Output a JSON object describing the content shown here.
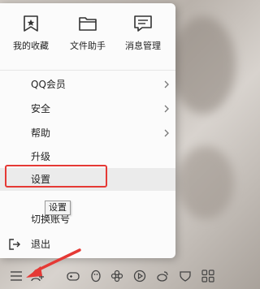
{
  "quick_actions": [
    {
      "label": "我的收藏",
      "icon": "favorites-icon"
    },
    {
      "label": "文件助手",
      "icon": "folder-icon"
    },
    {
      "label": "消息管理",
      "icon": "message-manage-icon"
    }
  ],
  "menu": {
    "qq_vip": "QQ会员",
    "security": "安全",
    "help": "帮助",
    "upgrade": "升级",
    "settings": "设置",
    "switch_account": "切换账号",
    "exit": "退出"
  },
  "tooltip": "设置",
  "colors": {
    "highlight_border": "#e53935",
    "hover_bg": "#ebebeb",
    "arrow": "#e53935"
  }
}
